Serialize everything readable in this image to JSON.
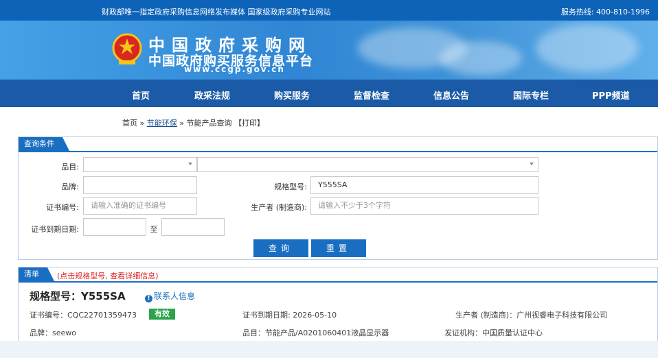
{
  "topbar": {
    "slogan": "财政部唯一指定政府采购信息网络发布媒体 国家级政府采购专业网站",
    "hotline": "服务热线: 400-810-1996"
  },
  "logo": {
    "line1": "中国政府采购网",
    "line2": "中国政府购买服务信息平台",
    "line3": "www.ccgp.gov.cn"
  },
  "nav": {
    "items": [
      "首页",
      "政采法规",
      "购买服务",
      "监督检查",
      "信息公告",
      "国际专栏",
      "PPP频道"
    ]
  },
  "breadcrumb": {
    "home": "首页",
    "sep1": " » ",
    "section": "节能环保",
    "sep2": " » ",
    "page": "节能产品查询",
    "print": "【打印】"
  },
  "query": {
    "title": "查询条件",
    "category_label": "品目:",
    "category_value": "",
    "subcategory_value": "",
    "brand_label": "品牌:",
    "brand_value": "",
    "model_label": "规格型号:",
    "model_value": "Y555SA",
    "cert_label": "证书编号:",
    "cert_placeholder": "请输入准确的证书编号",
    "maker_label": "生产者 (制造商):",
    "maker_placeholder": "请输入不少于3个字符",
    "expiry_label": "证书到期日期:",
    "expiry_from": "",
    "expiry_to_label": "至",
    "expiry_to": "",
    "search_button": "查询",
    "reset_button": "重置"
  },
  "results": {
    "title": "清单",
    "note": "(点击规格型号, 查看详细信息)",
    "item": {
      "model": "规格型号：Y555SA",
      "contact": "联系人信息",
      "cert_no": "证书编号：CQC22701359473",
      "status": "有效",
      "expiry": "证书到期日期: 2026-05-10",
      "maker": "生产者 (制造商)：广州视睿电子科技有限公司",
      "brand": "品牌：seewo",
      "category": "品目：节能产品/A0201060401液晶显示器",
      "issuer": "发证机构：中国质量认证中心"
    }
  },
  "colors": {
    "primary": "#1a6ec2",
    "nav_bg": "#1a5aa6",
    "valid_badge": "#2aa34a",
    "note_red": "#e02020"
  }
}
